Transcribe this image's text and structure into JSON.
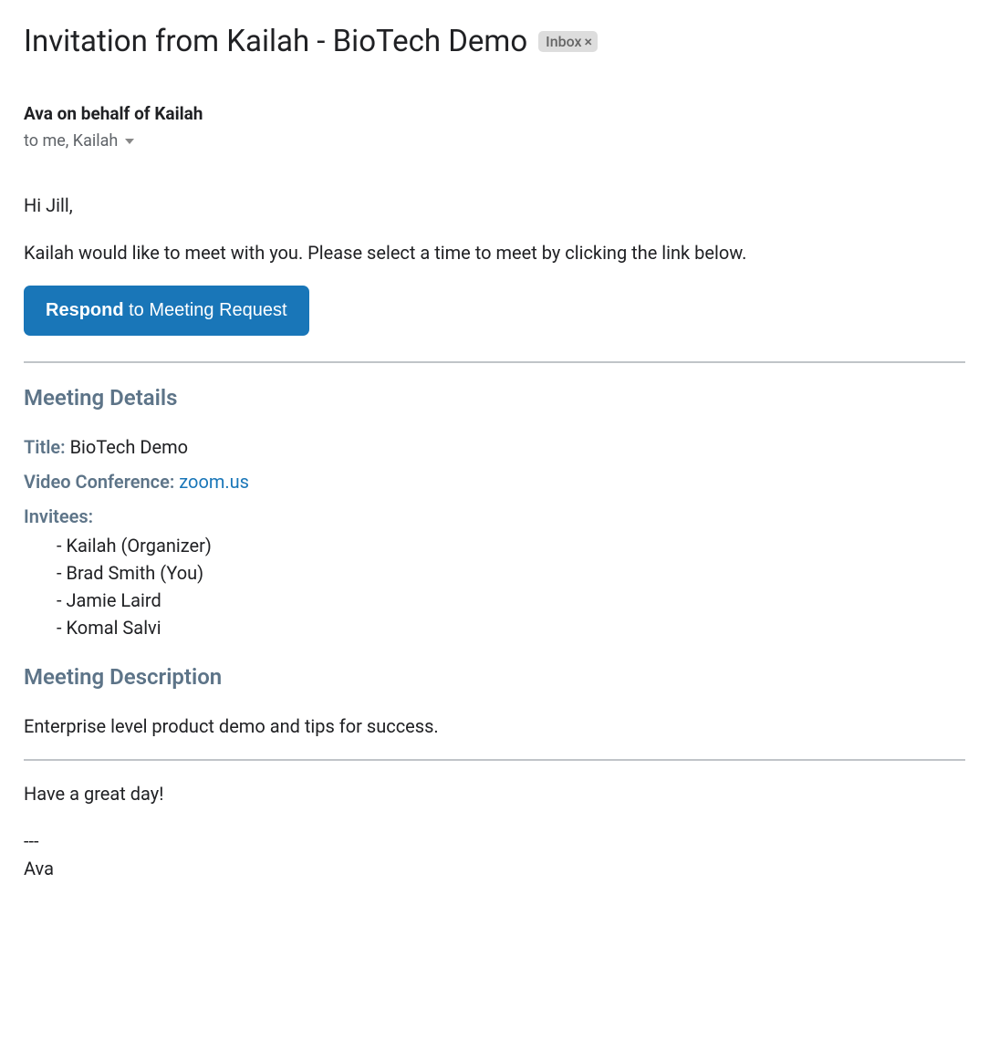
{
  "header": {
    "subject": "Invitation from Kailah - BioTech Demo",
    "label": "Inbox",
    "sender": "Ava on behalf of Kailah",
    "recipients": "to me, Kailah"
  },
  "body": {
    "greeting": "Hi Jill,",
    "intro": "Kailah would like to meet with you. Please select a time to meet by clicking the link below.",
    "button_bold": "Respond",
    "button_rest": " to Meeting Request"
  },
  "meeting_details": {
    "heading": "Meeting Details",
    "title_label": "Title:",
    "title_value": "BioTech Demo",
    "video_label": "Video Conference:",
    "video_link": "zoom.us",
    "invitees_label": "Invitees:",
    "invitees": [
      "Kailah (Organizer)",
      "Brad Smith (You)",
      "Jamie Laird",
      "Komal Salvi"
    ]
  },
  "description": {
    "heading": "Meeting Description",
    "text": "Enterprise level product demo and tips for success."
  },
  "footer": {
    "signoff": "Have a great day!",
    "separator": "---",
    "signature": "Ava"
  }
}
